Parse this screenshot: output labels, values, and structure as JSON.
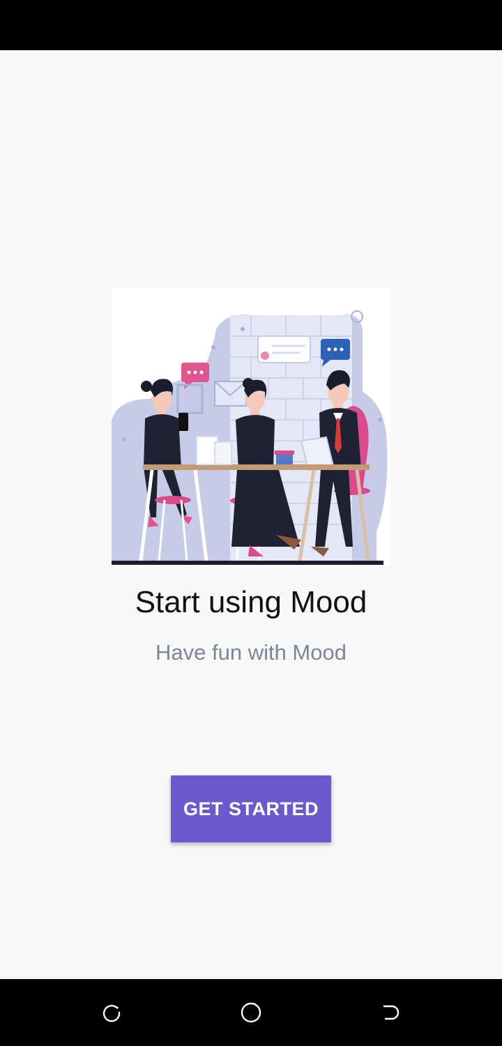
{
  "onboarding": {
    "illustration": "team-meeting-illustration",
    "title": "Start using Mood",
    "subtitle": "Have fun with Mood",
    "cta_label": "GET STARTED"
  },
  "nav": {
    "items": [
      "recent-apps-icon",
      "home-icon",
      "back-icon"
    ]
  },
  "colors": {
    "accent": "#6a5acd",
    "subtitle": "#7b8794",
    "background": "#f8f8f9"
  }
}
